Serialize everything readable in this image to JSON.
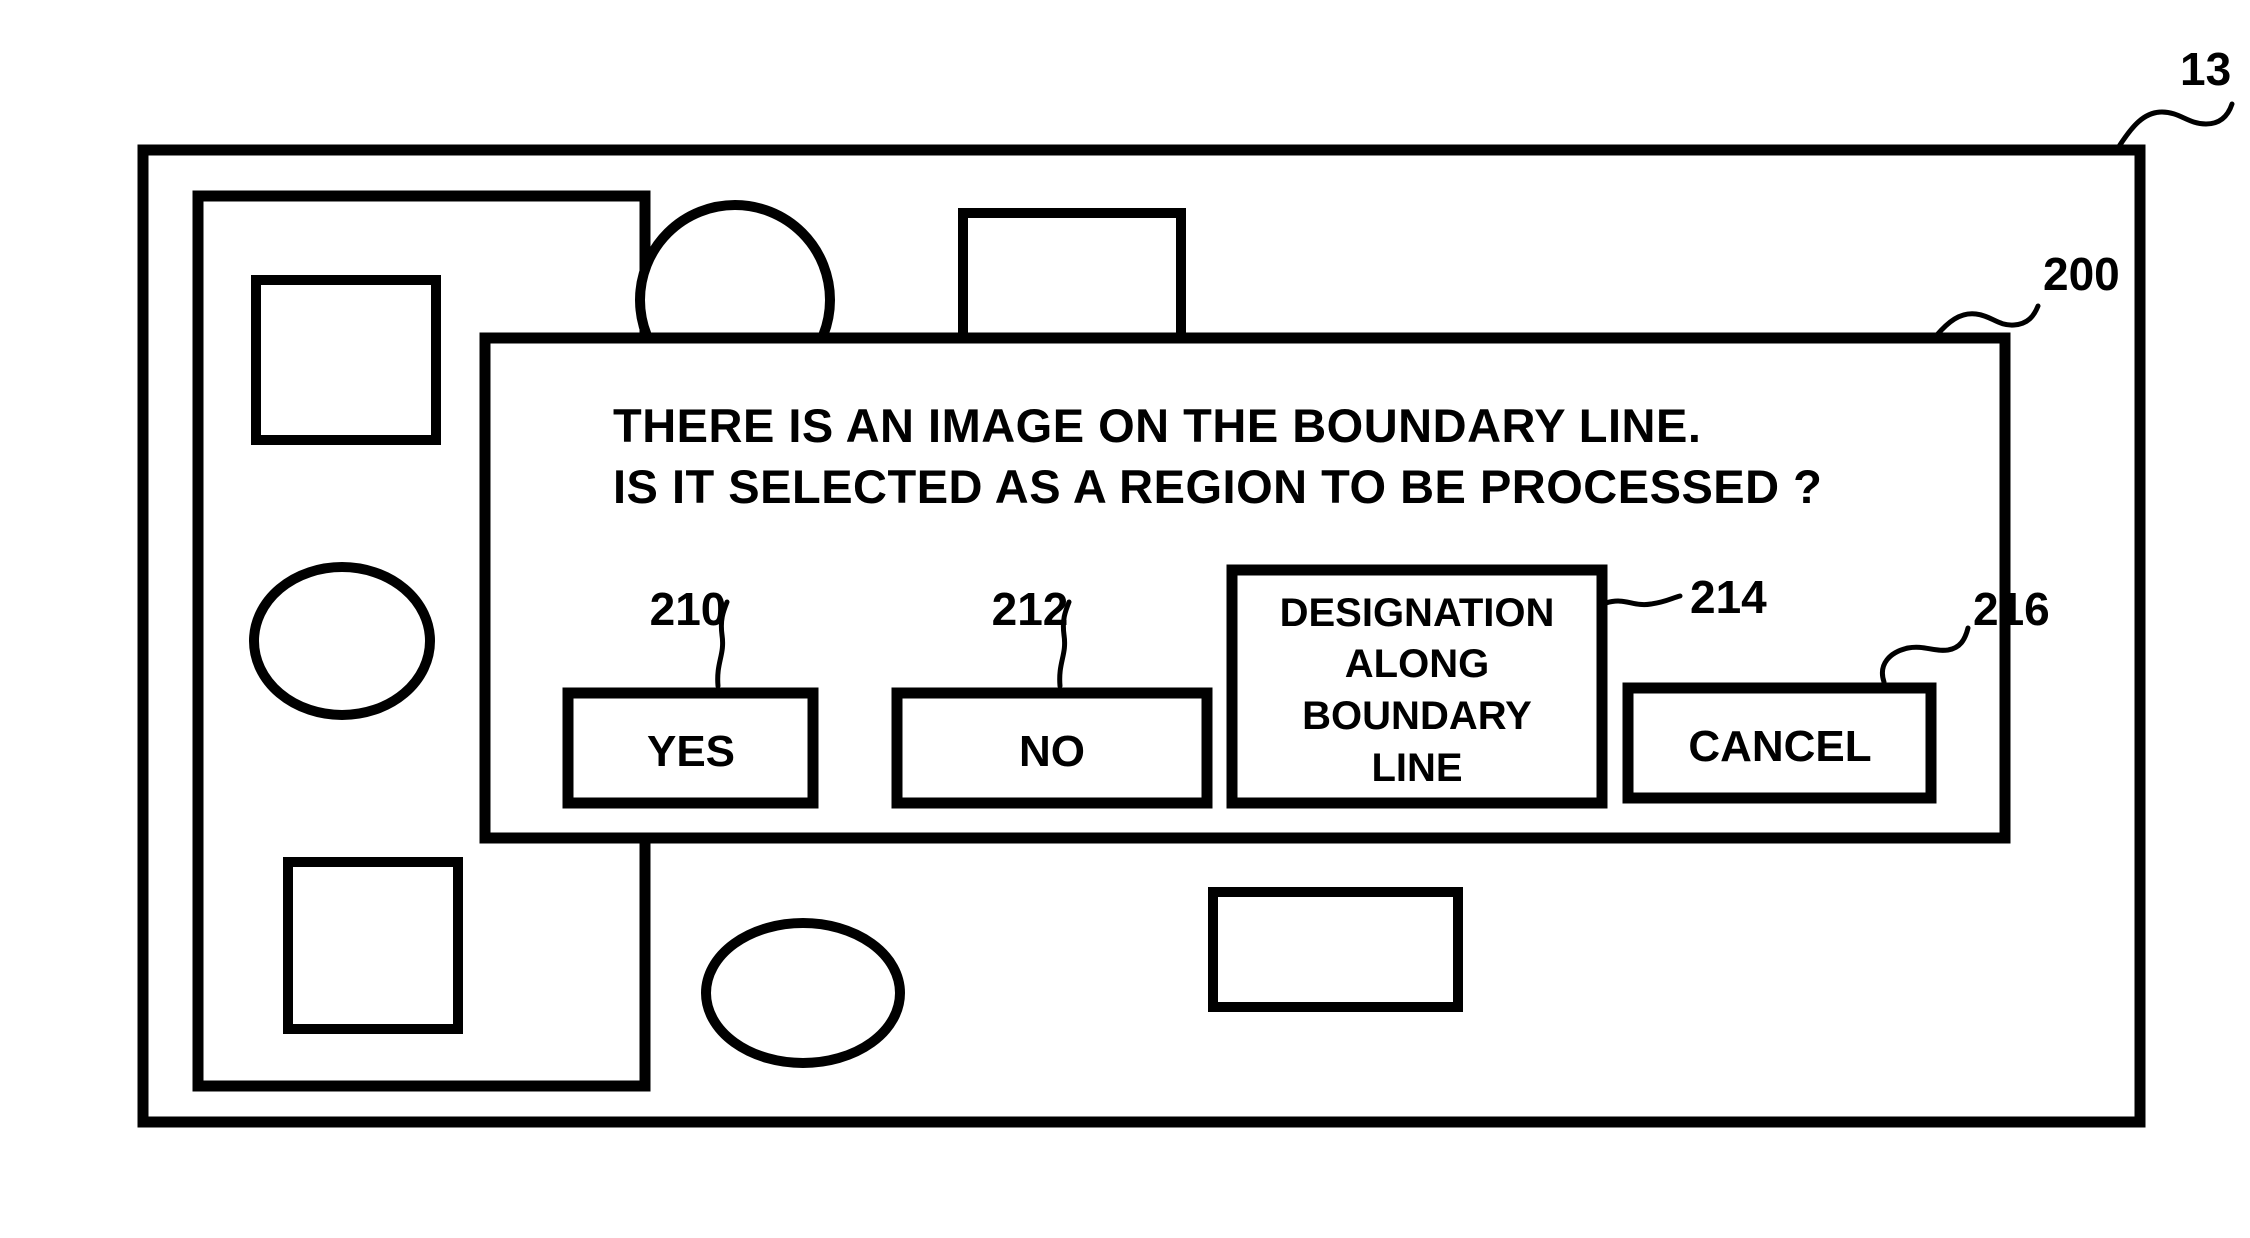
{
  "figure": {
    "label": "13",
    "dialog_label": "200",
    "background_color": "#ffffff",
    "ink_color": "#000000"
  },
  "canvas": {
    "outer_frame_name": "document-page-frame",
    "boundary_region_name": "boundary-region-rectangle",
    "objects": [
      {
        "name": "image-object-square-top-left",
        "shape": "square"
      },
      {
        "name": "image-object-ellipse-left",
        "shape": "ellipse"
      },
      {
        "name": "image-object-square-bottom-left",
        "shape": "square"
      },
      {
        "name": "image-object-circle-on-boundary-top",
        "shape": "circle"
      },
      {
        "name": "image-object-square-top-right",
        "shape": "square"
      },
      {
        "name": "image-object-ellipse-on-boundary-bottom",
        "shape": "ellipse"
      },
      {
        "name": "image-object-rectangle-bottom-right",
        "shape": "rectangle"
      }
    ]
  },
  "dialog": {
    "message_line_1": "THERE IS AN IMAGE ON THE BOUNDARY LINE.",
    "message_line_2": "IS IT SELECTED AS A REGION TO BE PROCESSED ?",
    "buttons": [
      {
        "id": "yes",
        "ref": "210",
        "lines": [
          "YES"
        ]
      },
      {
        "id": "no",
        "ref": "212",
        "lines": [
          "NO"
        ]
      },
      {
        "id": "designation-along-boundary-line",
        "ref": "214",
        "lines": [
          "DESIGNATION",
          "ALONG",
          "BOUNDARY",
          "LINE"
        ]
      },
      {
        "id": "cancel",
        "ref": "216",
        "lines": [
          "CANCEL"
        ]
      }
    ]
  }
}
